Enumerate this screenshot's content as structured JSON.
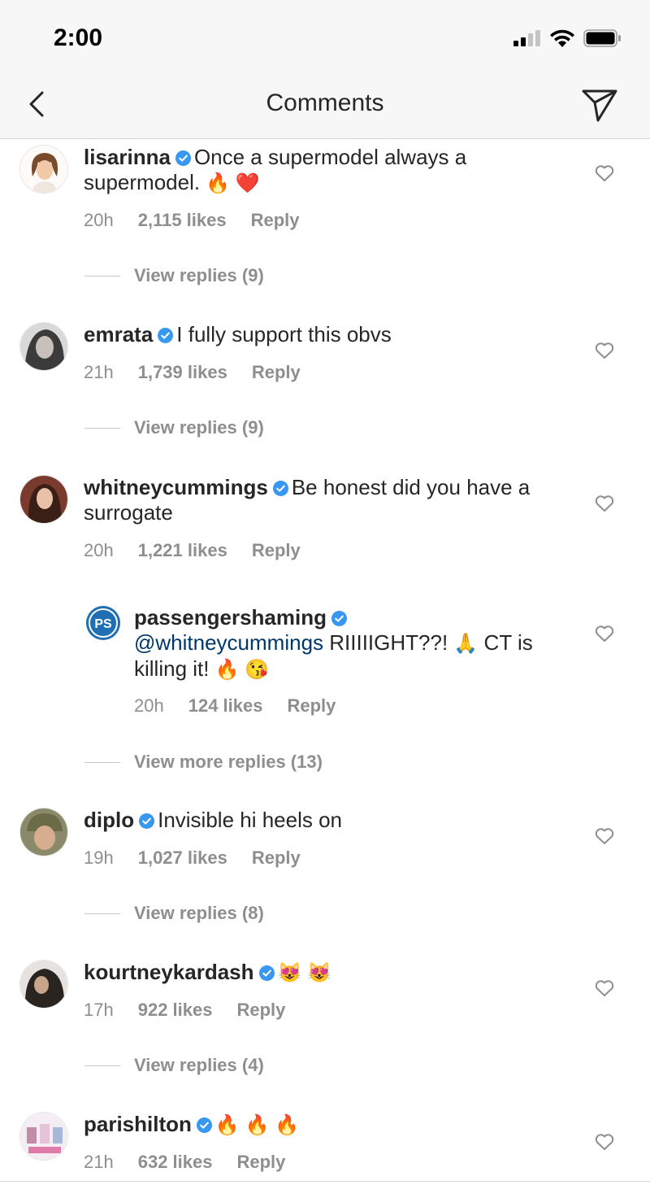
{
  "status": {
    "time": "2:00"
  },
  "header": {
    "title": "Comments"
  },
  "colors": {
    "accent": "#3897f0",
    "text": "#262626",
    "muted": "#8e8e8e",
    "mention": "#00376b",
    "fire": "#ff5a00",
    "heart_red": "#ed1c24"
  },
  "comments": [
    {
      "username": "lisarinna",
      "text": "Once a supermodel always a supermodel.",
      "emojis": "🔥 ❤️",
      "time": "20h",
      "likes": "2,115 likes",
      "reply": "Reply",
      "view": "View replies (9)"
    },
    {
      "username": "emrata",
      "text": "I fully support this obvs",
      "time": "21h",
      "likes": "1,739 likes",
      "reply": "Reply",
      "view": "View replies (9)"
    },
    {
      "username": "whitneycummings",
      "text": "Be honest did you have a surrogate",
      "time": "20h",
      "likes": "1,221 likes",
      "reply": "Reply"
    },
    {
      "username": "diplo",
      "text": "Invisible hi heels on",
      "time": "19h",
      "likes": "1,027 likes",
      "reply": "Reply",
      "view": "View replies (8)"
    },
    {
      "username": "kourtneykardash",
      "emojis": "😻 😻",
      "time": "17h",
      "likes": "922 likes",
      "reply": "Reply",
      "view": "View replies (4)"
    },
    {
      "username": "parishilton",
      "emojis": "🔥 🔥 🔥",
      "time": "21h",
      "likes": "632 likes",
      "reply": "Reply"
    }
  ],
  "reply": {
    "username": "passengershaming",
    "avatar_text": "PS",
    "mention": "@whitneycummings",
    "text": "RIIIIIGHT??!",
    "emoji1": "🙏",
    "text2": "CT is killing it!",
    "emoji2": "🔥 😘",
    "time": "20h",
    "likes": "124 likes",
    "reply": "Reply",
    "view_more": "View more replies (13)"
  }
}
